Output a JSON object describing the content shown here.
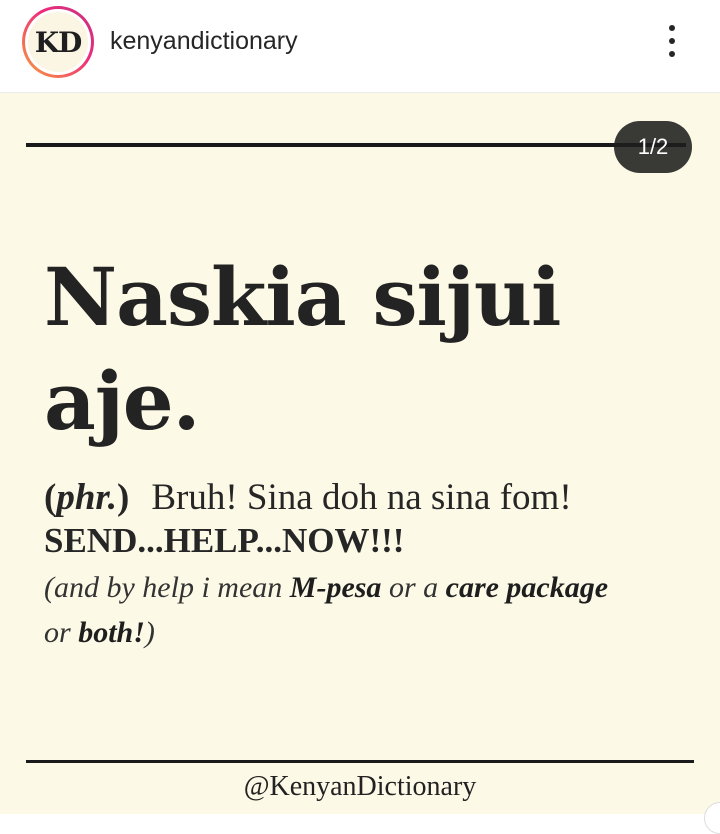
{
  "header": {
    "avatar_text": "KD",
    "username": "kenyandictionary"
  },
  "post": {
    "counter": "1/2",
    "headword_line1": "Naskia sijui",
    "headword_line2": "aje.",
    "definition": {
      "open_paren": "(",
      "pos": "phr.",
      "close_paren": ")",
      "text": "Bruh! Sina doh na sina fom!",
      "line2": "SEND...HELP...NOW!!!",
      "note_open": "(and by help i mean ",
      "note_mpesa": "M-pesa",
      "note_or": " or a ",
      "note_care": "care package",
      "note_or2": "or ",
      "note_both": "both!",
      "note_close": ")"
    },
    "handle": "@KenyanDictionary"
  },
  "colors": {
    "post_background": "#fcf9e6",
    "ink": "#232323",
    "story_ring_start": "#f9a13a",
    "story_ring_end": "#c13584"
  }
}
